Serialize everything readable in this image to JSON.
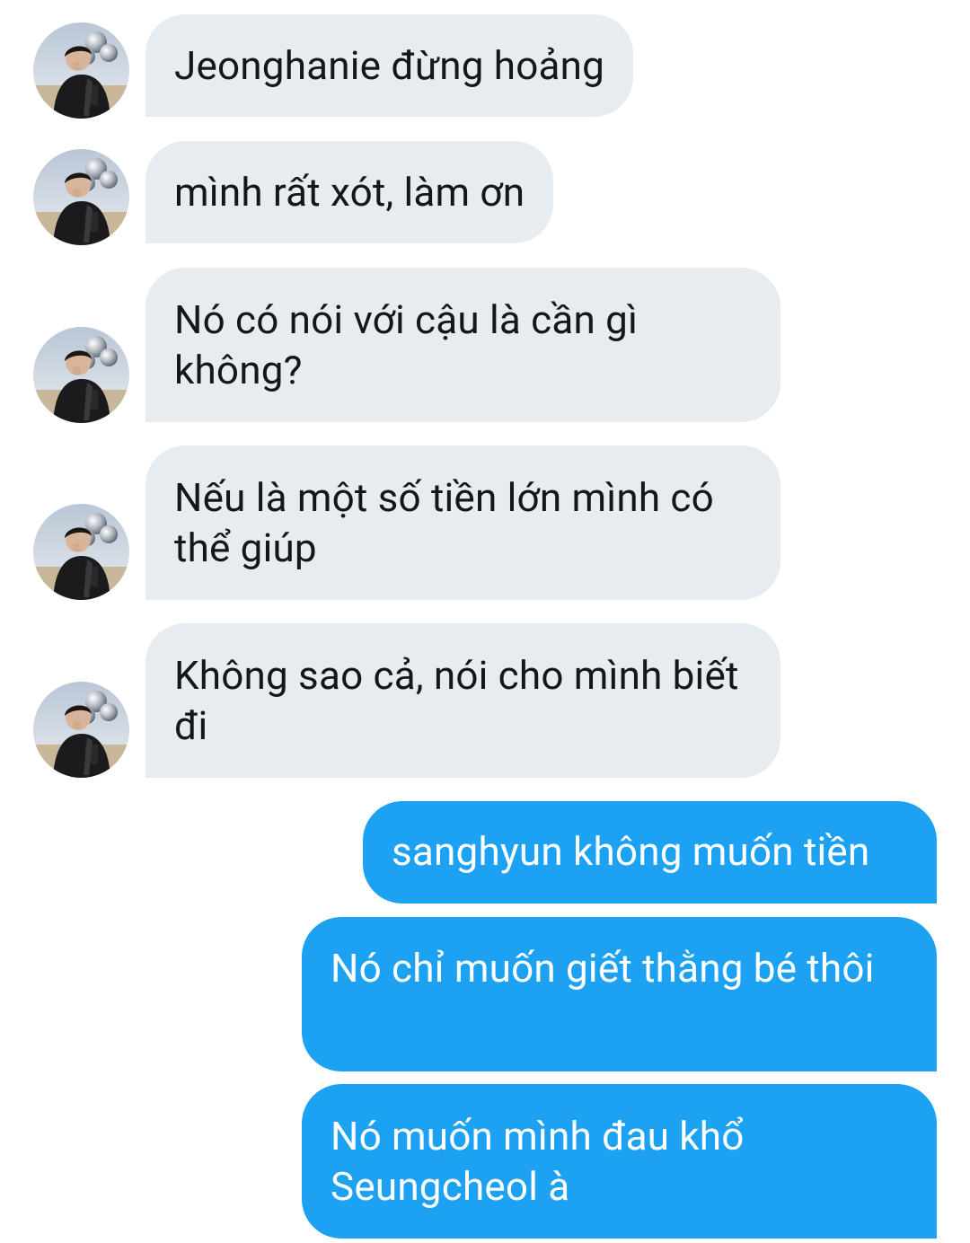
{
  "conversation": {
    "incoming_avatar": "profile-photo-avatar",
    "messages": [
      {
        "direction": "in",
        "text": "Jeonghanie đừng hoảng"
      },
      {
        "direction": "in",
        "text": "mình rất xót, làm ơn"
      },
      {
        "direction": "in",
        "text": "Nó có nói với cậu là cần gì không?"
      },
      {
        "direction": "in",
        "text": "Nếu là một số tiền lớn mình có thể giúp"
      },
      {
        "direction": "in",
        "text": "Không sao cả, nói cho mình biết đi"
      },
      {
        "direction": "out",
        "text": "sanghyun không muốn tiền"
      },
      {
        "direction": "out",
        "text": "Nó chỉ muốn giết thằng bé thôi"
      },
      {
        "direction": "out",
        "text": "Nó muốn mình đau khổ Seungcheol à"
      }
    ]
  },
  "colors": {
    "incoming_bubble": "#e6ecf0",
    "outgoing_bubble": "#1da1f2",
    "incoming_text": "#14171a",
    "outgoing_text": "#ffffff"
  }
}
